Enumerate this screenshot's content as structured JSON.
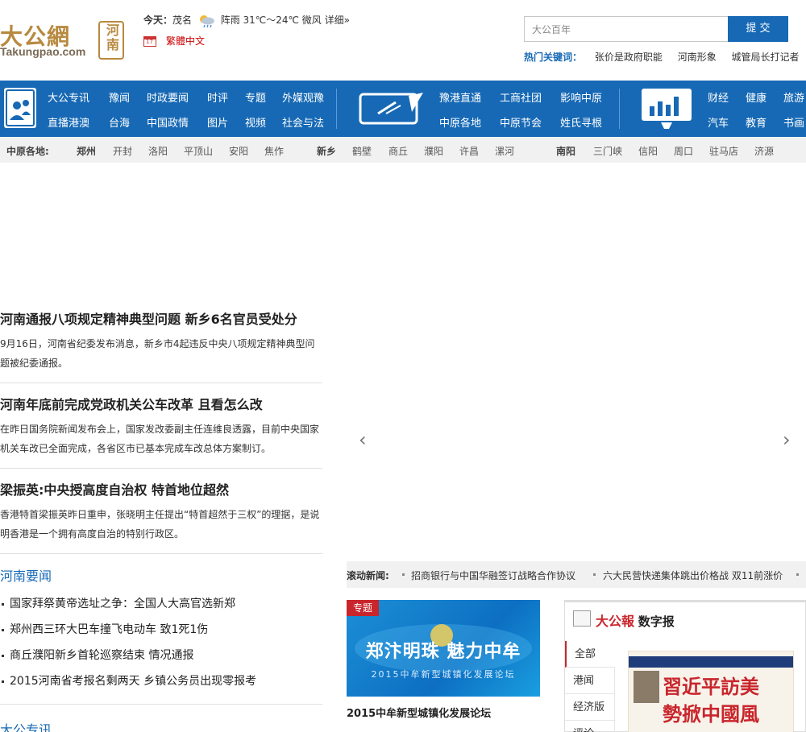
{
  "header": {
    "logo_cn": "大公網",
    "logo_en": "Takungpao.com",
    "logo_region": "河南",
    "weather_label": "今天：",
    "weather_city": "茂名",
    "weather_desc": "阵雨 31℃～24℃ 微风",
    "weather_more": "详细»",
    "traditional_link": "繁體中文",
    "search_placeholder": "大公百年",
    "search_button": "提 交",
    "hot_title": "热门关键词：",
    "hot_keywords": [
      "张价是政府职能",
      "河南形象",
      "城管局长打记者"
    ]
  },
  "nav": {
    "group1": [
      [
        "大公专讯",
        "豫闻",
        "时政要闻",
        "时评",
        "专题",
        "外媒观豫"
      ],
      [
        "直播港澳",
        "台海",
        "中国政情",
        "图片",
        "视频",
        "社会与法"
      ]
    ],
    "group2": [
      [
        "豫港直通",
        "工商社团",
        "影响中原"
      ],
      [
        "中原各地",
        "中原节会",
        "姓氏寻根"
      ]
    ],
    "group3": [
      [
        "财经",
        "健康",
        "旅游"
      ],
      [
        "汽车",
        "教育",
        "书画"
      ]
    ]
  },
  "region": {
    "label": "中原各地:",
    "items": [
      "郑州",
      "开封",
      "洛阳",
      "平顶山",
      "安阳",
      "焦作",
      "新乡",
      "鹤壁",
      "商丘",
      "濮阳",
      "许昌",
      "漯河",
      "南阳",
      "三门峡",
      "信阳",
      "周口",
      "驻马店",
      "济源"
    ]
  },
  "headlines": [
    {
      "title": "河南通报八项规定精神典型问题 新乡6名官员受处分",
      "desc": "9月16日，河南省纪委发布消息，新乡市4起违反中央八项规定精神典型问题被纪委通报。"
    },
    {
      "title": "河南年底前完成党政机关公车改革 且看怎么改",
      "desc": "在昨日国务院新闻发布会上，国家发改委副主任连维良透露，目前中央国家机关车改已全面完成，各省区市已基本完成车改总体方案制订。"
    },
    {
      "title": "梁振英:中央授高度自治权 特首地位超然",
      "desc": "香港特首梁振英昨日重申，张晓明主任提出“特首超然于三权”的理据，是说明香港是一个拥有高度自治的特别行政区。"
    }
  ],
  "slider": {
    "prev": "‹",
    "next": "›"
  },
  "henan_news": {
    "title": "河南要闻",
    "items": [
      "国家拜祭黄帝选址之争：全国人大高官选新郑",
      "郑州西三环大巴车撞飞电动车 致1死1伤",
      "商丘濮阳新乡首轮巡察结束 情况通报",
      "2015河南省考报名剩两天 乡镇公务员出现零报考"
    ]
  },
  "dagong_section": {
    "title": "大公专讯"
  },
  "ticker": {
    "label": "滚动新闻:",
    "items": [
      "招商银行与中国华融签订战略合作协议",
      "六大民营快递集体跳出价格战 双11前涨价"
    ]
  },
  "special": {
    "tag": "专题",
    "main": "郑汴明珠 魅力中牟",
    "sub": "2015中牟新型城镇化发展论坛",
    "caption": "2015中牟新型城镇化发展论坛"
  },
  "digital_paper": {
    "logo": "大公報",
    "title": "数字报",
    "tabs": [
      "全部",
      "港闻",
      "经济版",
      "评论"
    ],
    "cover_h1": "習近平訪美",
    "cover_h2": "勢掀中國風"
  },
  "colors": {
    "brand_blue": "#1769b5",
    "accent_red": "#c9252c",
    "logo_gold": "#b8893f"
  }
}
